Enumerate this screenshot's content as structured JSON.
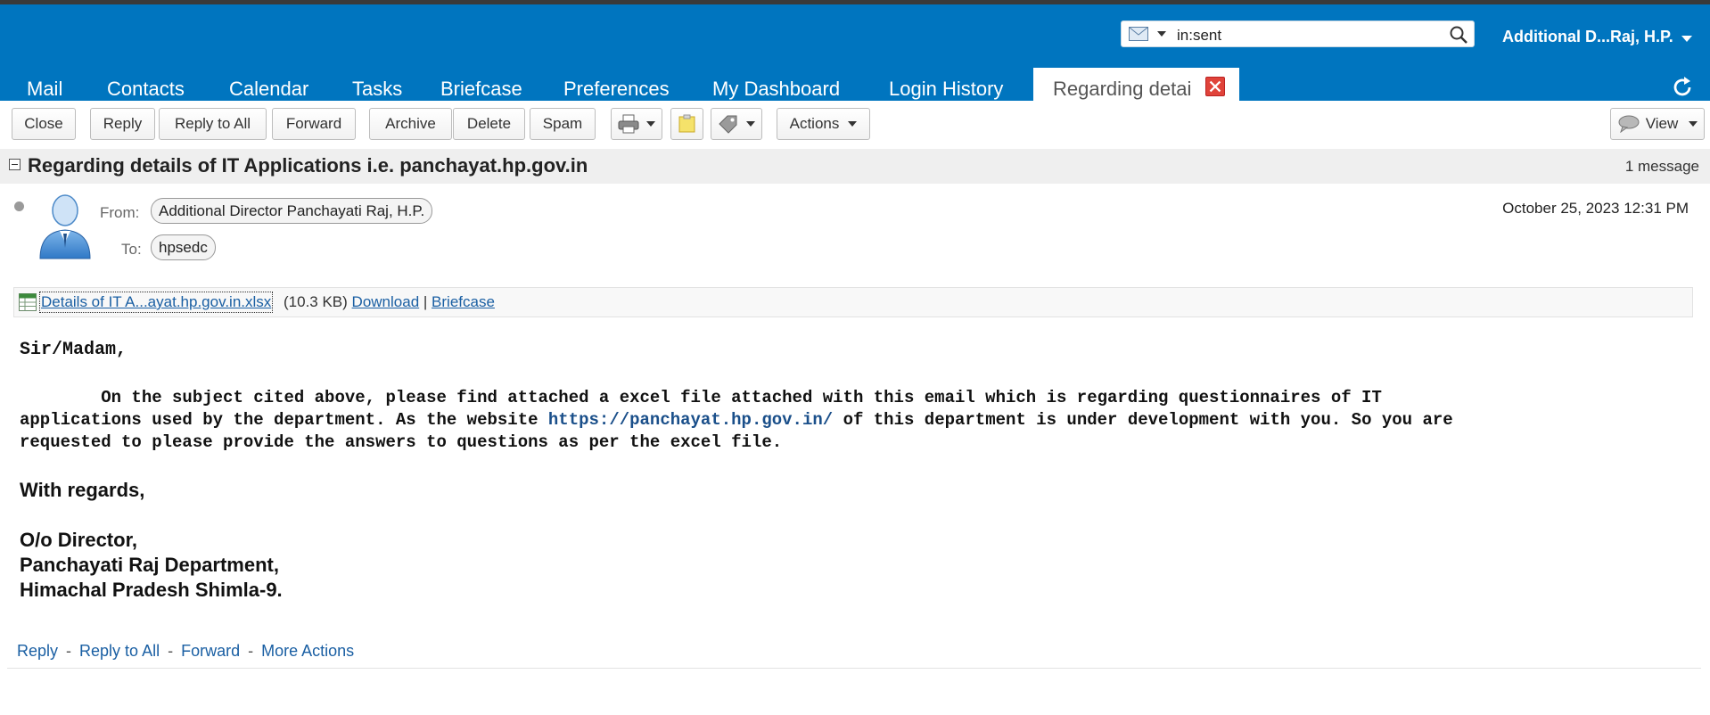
{
  "search": {
    "query": "in:sent"
  },
  "user": {
    "name": "Additional D...Raj, H.P."
  },
  "tabs": [
    "Mail",
    "Contacts",
    "Calendar",
    "Tasks",
    "Briefcase",
    "Preferences",
    "My Dashboard",
    "Login History"
  ],
  "active_tab": {
    "label": "Regarding detai"
  },
  "toolbar": {
    "close": "Close",
    "reply": "Reply",
    "reply_all": "Reply to All",
    "forward": "Forward",
    "archive": "Archive",
    "delete": "Delete",
    "spam": "Spam",
    "actions": "Actions",
    "view": "View"
  },
  "conversation": {
    "subject": "Regarding details of IT Applications i.e. panchayat.hp.gov.in",
    "count": "1 message"
  },
  "message": {
    "from_label": "From:",
    "from": "Additional Director Panchayati Raj, H.P.",
    "to_label": "To:",
    "to": "hpsedc",
    "date": "October 25, 2023 12:31 PM"
  },
  "attachment": {
    "name": "Details of IT A...ayat.hp.gov.in.xlsx",
    "size": "(10.3 KB)",
    "download": "Download",
    "separator": "|",
    "briefcase": "Briefcase"
  },
  "body": {
    "greeting": "Sir/Madam,",
    "line1": "        On the subject cited above, please find attached a excel file attached with this email which is regarding questionnaires of IT",
    "line2_pre": "applications used by the department. As the website ",
    "link": "https://panchayat.hp.gov.in/",
    "line2_post": " of this department is under development with you. So you are",
    "line3": "requested to please provide the answers to questions as per the excel file.",
    "regards": "With regards,",
    "sig1": "O/o Director,",
    "sig2": "Panchayati Raj Department,",
    "sig3": "Himachal Pradesh Shimla-9."
  },
  "footer": {
    "reply": "Reply",
    "reply_all": "Reply to All",
    "forward": "Forward",
    "more": "More Actions",
    "sep": "-"
  },
  "colors": {
    "header_bg": "#0075bf",
    "link": "#1a5fa3",
    "close_red": "#e0433a"
  }
}
